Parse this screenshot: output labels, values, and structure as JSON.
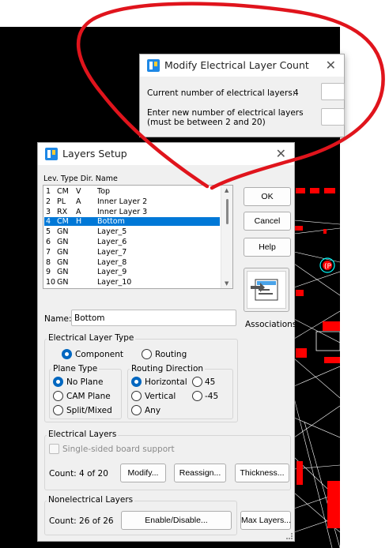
{
  "modify_dialog": {
    "title": "Modify Electrical Layer Count",
    "current_label": "Current number of electrical layers:",
    "current_value": "4",
    "enter_label_line1": "Enter new number of electrical layers",
    "enter_label_line2": "(must be between  2 and 20)"
  },
  "layers_dialog": {
    "title": "Layers Setup",
    "list_header": "Lev.  Type  Dir.  Name",
    "layers": [
      {
        "lev": "1",
        "type": "CM",
        "dir": "V",
        "name": "Top"
      },
      {
        "lev": "2",
        "type": "PL",
        "dir": "A",
        "name": "Inner Layer 2"
      },
      {
        "lev": "3",
        "type": "RX",
        "dir": "A",
        "name": "Inner Layer 3"
      },
      {
        "lev": "4",
        "type": "CM",
        "dir": "H",
        "name": "Bottom"
      },
      {
        "lev": "5",
        "type": "GN",
        "dir": "",
        "name": "Layer_5"
      },
      {
        "lev": "6",
        "type": "GN",
        "dir": "",
        "name": "Layer_6"
      },
      {
        "lev": "7",
        "type": "GN",
        "dir": "",
        "name": "Layer_7"
      },
      {
        "lev": "8",
        "type": "GN",
        "dir": "",
        "name": "Layer_8"
      },
      {
        "lev": "9",
        "type": "GN",
        "dir": "",
        "name": "Layer_9"
      },
      {
        "lev": "10",
        "type": "GN",
        "dir": "",
        "name": "Layer_10"
      }
    ],
    "selected_index": 3,
    "buttons": {
      "ok": "OK",
      "cancel": "Cancel",
      "help": "Help",
      "associations": "Associations"
    },
    "name_label": "Name:",
    "name_value": "Bottom",
    "electrical_layer_type": {
      "label": "Electrical  Layer Type",
      "component": "Component",
      "routing": "Routing",
      "selected": "Component"
    },
    "plane_type": {
      "label": "Plane Type",
      "options": [
        "No Plane",
        "CAM Plane",
        "Split/Mixed"
      ],
      "selected": "No Plane"
    },
    "routing_direction": {
      "label": "Routing Direction",
      "options": [
        "Horizontal",
        "Vertical",
        "Any",
        "45",
        "-45"
      ],
      "selected": "Horizontal"
    },
    "electrical_layers": {
      "label": "Electrical Layers",
      "single_sided": "Single-sided board support",
      "count_text": "Count:  4 of 20",
      "modify": "Modify...",
      "reassign": "Reassign...",
      "thickness": "Thickness..."
    },
    "nonelectrical_layers": {
      "label": "Nonelectrical Layers",
      "count_text": "Count: 26 of 26",
      "enable_disable": "Enable/Disable...",
      "max_layers": "Max Layers..."
    }
  },
  "pcb": {
    "pad_label": "(P"
  },
  "colors": {
    "annotation": "#e0141c",
    "selection": "#0078d7",
    "radio_on": "#0067c0",
    "pcb_background": "#000000",
    "pcb_pad": "#ff0000",
    "pcb_trace": "#ffffff",
    "pcb_highlight": "#00ffff"
  }
}
